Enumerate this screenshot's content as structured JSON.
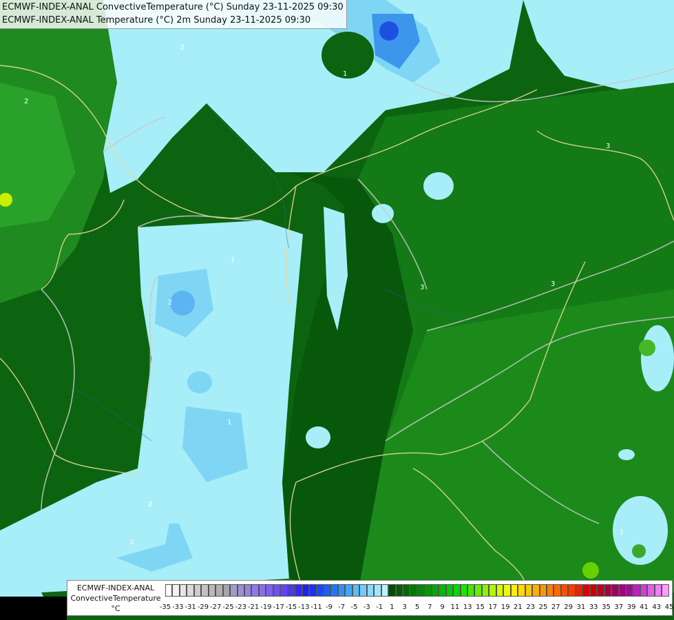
{
  "header": {
    "line1": "ECMWF-INDEX-ANAL ConvectiveTemperature (°C) Sunday 23-11-2025 09:30",
    "line2": "ECMWF-INDEX-ANAL Temperature (°C) 2m Sunday 23-11-2025 09:30"
  },
  "legend": {
    "model": "ECMWF-INDEX-ANAL",
    "parameter": "ConvectiveTemperature",
    "unit": "°C",
    "tick_labels": [
      "-35",
      "-33",
      "-31",
      "-29",
      "-27",
      "-25",
      "-23",
      "-21",
      "-19",
      "-17",
      "-15",
      "-13",
      "-11",
      "-9",
      "-7",
      "-5",
      "-3",
      "-1",
      "1",
      "3",
      "5",
      "7",
      "9",
      "11",
      "13",
      "15",
      "17",
      "19",
      "21",
      "23",
      "25",
      "27",
      "29",
      "31",
      "33",
      "35",
      "37",
      "39",
      "41",
      "43",
      "45"
    ],
    "colors": [
      "#ffffff",
      "#f2f2f2",
      "#e6e6e6",
      "#dadada",
      "#cecece",
      "#c2c2c2",
      "#b9b9b9",
      "#b0b0b0",
      "#a6a6b0",
      "#a09cc4",
      "#9a90d6",
      "#9884e0",
      "#9278e8",
      "#8a6cf0",
      "#7f60f4",
      "#6f52f6",
      "#5f44f8",
      "#4a36f8",
      "#3428f8",
      "#1e1ef8",
      "#1a30f8",
      "#1a48f8",
      "#1a60f8",
      "#2078f8",
      "#3090f8",
      "#40a8f8",
      "#58bcf8",
      "#70ccf8",
      "#88dcf8",
      "#a0e8f8",
      "#b8f4f8",
      "#004d00",
      "#005c00",
      "#006b00",
      "#007a00",
      "#008a00",
      "#009a00",
      "#00aa00",
      "#00ba00",
      "#00ca00",
      "#00da00",
      "#1ae600",
      "#40ea00",
      "#66ee00",
      "#8cf200",
      "#b2f600",
      "#d8fa00",
      "#f0fa00",
      "#fff000",
      "#ffdc00",
      "#ffc800",
      "#ffb000",
      "#ff9800",
      "#ff8000",
      "#ff6800",
      "#ff5000",
      "#ff3800",
      "#f02000",
      "#e00000",
      "#cc0000",
      "#b80020",
      "#a80040",
      "#a00060",
      "#a40080",
      "#b000a0",
      "#c020c0",
      "#d040d8",
      "#e060e8",
      "#f080f4",
      "#ff9cff"
    ]
  },
  "map": {
    "contour_labels": [
      {
        "text": "2"
      },
      {
        "text": "1"
      },
      {
        "text": "3"
      },
      {
        "text": "2"
      },
      {
        "text": "1"
      },
      {
        "text": "2"
      },
      {
        "text": "3"
      },
      {
        "text": "1"
      },
      {
        "text": "2"
      },
      {
        "text": "3"
      },
      {
        "text": "1"
      },
      {
        "text": "2"
      }
    ]
  }
}
